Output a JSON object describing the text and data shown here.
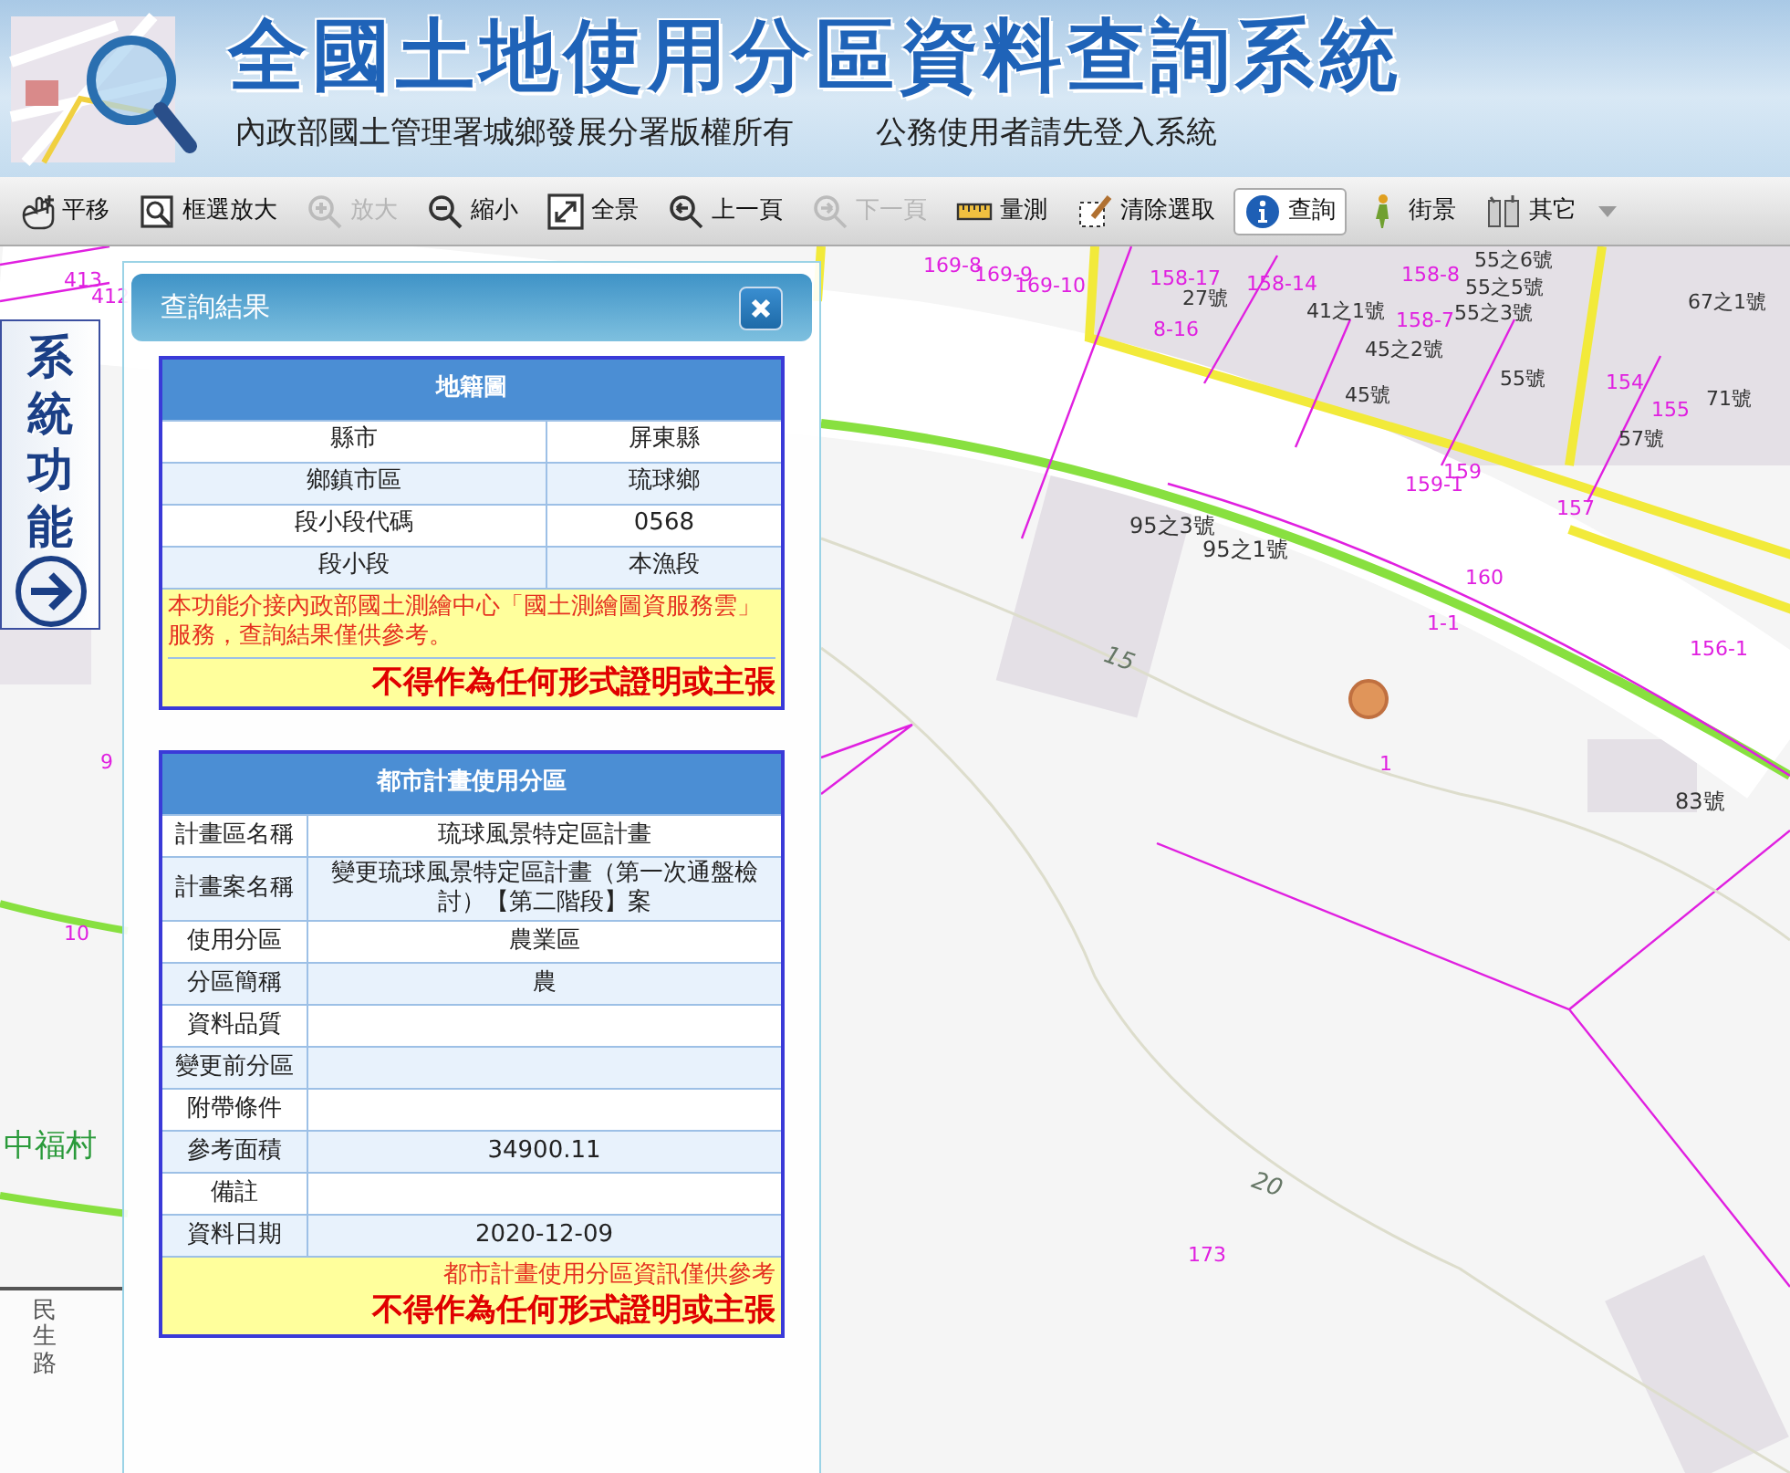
{
  "header": {
    "title": "全國土地使用分區資料查詢系統",
    "subtitle": "內政部國土管理署城鄉發展分署版權所有",
    "notice": "公務使用者請先登入系統"
  },
  "toolbar": [
    {
      "label": "平移",
      "kind": "button",
      "disabled": false,
      "selected": false
    },
    {
      "label": "框選放大",
      "kind": "button",
      "disabled": false,
      "selected": false
    },
    {
      "label": "放大",
      "kind": "button",
      "disabled": true,
      "selected": false
    },
    {
      "label": "縮小",
      "kind": "button",
      "disabled": false,
      "selected": false
    },
    {
      "label": "全景",
      "kind": "button",
      "disabled": false,
      "selected": false
    },
    {
      "label": "上一頁",
      "kind": "button",
      "disabled": false,
      "selected": false
    },
    {
      "label": "下一頁",
      "kind": "button",
      "disabled": true,
      "selected": false
    },
    {
      "label": "量測",
      "kind": "button",
      "disabled": false,
      "selected": false
    },
    {
      "label": "清除選取",
      "kind": "button",
      "disabled": false,
      "selected": false
    },
    {
      "label": "查詢",
      "kind": "button",
      "disabled": false,
      "selected": true
    },
    {
      "label": "街景",
      "kind": "button",
      "disabled": false,
      "selected": false
    },
    {
      "label": "其它",
      "kind": "dropdown",
      "disabled": false,
      "selected": false
    }
  ],
  "side_tab": {
    "label": "系統功能"
  },
  "map": {
    "labels": [
      {
        "text": "413",
        "color": "#e020e0"
      },
      {
        "text": "412",
        "color": "#e020e0"
      },
      {
        "text": "9",
        "color": "#e020e0"
      },
      {
        "text": "10",
        "color": "#e020e0"
      },
      {
        "text": "中福村",
        "color": "#2a9a3a"
      },
      {
        "text": "民生路",
        "color": "#555555"
      },
      {
        "text": "169-8",
        "color": "#e020e0"
      },
      {
        "text": "169-9",
        "color": "#e020e0"
      },
      {
        "text": "169-10",
        "color": "#e020e0"
      },
      {
        "text": "158-17",
        "color": "#e020e0"
      },
      {
        "text": "158-14",
        "color": "#e020e0"
      },
      {
        "text": "27號",
        "color": "#333333"
      },
      {
        "text": "8-16",
        "color": "#e020e0"
      },
      {
        "text": "41之1號",
        "color": "#333333"
      },
      {
        "text": "158-8",
        "color": "#e020e0"
      },
      {
        "text": "55之6號",
        "color": "#333333"
      },
      {
        "text": "55之5號",
        "color": "#333333"
      },
      {
        "text": "158-7",
        "color": "#e020e0"
      },
      {
        "text": "55之3號",
        "color": "#333333"
      },
      {
        "text": "45之2號",
        "color": "#333333"
      },
      {
        "text": "45號",
        "color": "#333333"
      },
      {
        "text": "55號",
        "color": "#333333"
      },
      {
        "text": "154",
        "color": "#e020e0"
      },
      {
        "text": "155",
        "color": "#e020e0"
      },
      {
        "text": "71號",
        "color": "#333333"
      },
      {
        "text": "57號",
        "color": "#333333"
      },
      {
        "text": "67之1號",
        "color": "#333333"
      },
      {
        "text": "159",
        "color": "#e020e0"
      },
      {
        "text": "159-1",
        "color": "#e020e0"
      },
      {
        "text": "157",
        "color": "#e020e0"
      },
      {
        "text": "95之3號",
        "color": "#333333"
      },
      {
        "text": "95之1號",
        "color": "#333333"
      },
      {
        "text": "160",
        "color": "#e020e0"
      },
      {
        "text": "1-1",
        "color": "#e020e0"
      },
      {
        "text": "156-1",
        "color": "#e020e0"
      },
      {
        "text": "15",
        "color": "#667766"
      },
      {
        "text": "1",
        "color": "#e020e0"
      },
      {
        "text": "83號",
        "color": "#333333"
      },
      {
        "text": "20",
        "color": "#667766"
      },
      {
        "text": "173",
        "color": "#e020e0"
      }
    ]
  },
  "query_panel": {
    "title": "查詢結果",
    "sections": [
      {
        "kind": "cadastral",
        "heading": "地籍圖",
        "rows": [
          {
            "label": "縣市",
            "value": "屏東縣"
          },
          {
            "label": "鄉鎮市區",
            "value": "琉球鄉"
          },
          {
            "label": "段小段代碼",
            "value": "0568"
          },
          {
            "label": "段小段",
            "value": "本漁段"
          }
        ],
        "notes": [
          {
            "kind": "info",
            "text": "本功能介接內政部國土測繪中心「國土測繪圖資服務雲」服務，查詢結果僅供參考。"
          },
          {
            "kind": "warning",
            "text": "不得作為任何形式證明或主張"
          }
        ]
      },
      {
        "kind": "zoning",
        "heading": "都市計畫使用分區",
        "rows": [
          {
            "label": "計畫區名稱",
            "value": "琉球風景特定區計畫"
          },
          {
            "label": "計畫案名稱",
            "value": "變更琉球風景特定區計畫（第一次通盤檢討）【第二階段】案"
          },
          {
            "label": "使用分區",
            "value": "農業區"
          },
          {
            "label": "分區簡稱",
            "value": "農"
          },
          {
            "label": "資料品質"
          },
          {
            "label": "變更前分區"
          },
          {
            "label": "附帶條件"
          },
          {
            "label": "參考面積",
            "value": "34900.11"
          },
          {
            "label": "備註"
          },
          {
            "label": "資料日期",
            "value": "2020-12-09"
          }
        ],
        "notes": [
          {
            "kind": "info",
            "text": "都市計畫使用分區資訊僅供參考"
          },
          {
            "kind": "warning",
            "text": "不得作為任何形式證明或主張"
          }
        ]
      }
    ]
  }
}
